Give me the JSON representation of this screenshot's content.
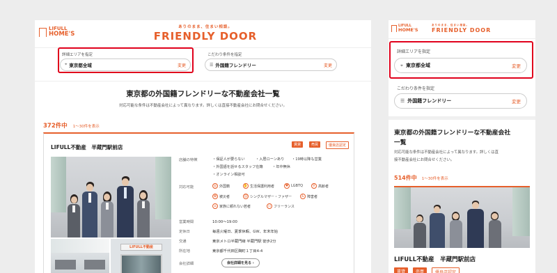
{
  "brand": {
    "logo_top": "LIFULL",
    "logo_bottom": "HOME'S",
    "tagline": "ありのまま、住まい相談。",
    "product": "FRIENDLY DOOR"
  },
  "filters": {
    "area_label": "詳細エリアを指定",
    "area_value": "東京都全域",
    "condition_label": "こだわり条件を指定",
    "condition_value": "外国籍フレンドリー",
    "change": "変更"
  },
  "results": {
    "heading": "東京都の外国籍フレンドリーな不動産会社一覧",
    "heading_mobile_1": "東京都の外国籍フレンドリーな不動産会社",
    "heading_mobile_2": "一覧",
    "note": "対応可能な条件は不動産会社によって異なります。詳しくは直接不動産会社にお問合せください。",
    "note_mobile_1": "対応可能な条件は不動産会社によって異なります。詳しくは直",
    "note_mobile_2": "接不動産会社にお問合せください。",
    "count_desktop": "372件中",
    "count_mobile": "514件中",
    "range": "1〜30件を表示"
  },
  "company": {
    "name_desktop": "LIFULL不動産　半蔵門駅前店",
    "name_mobile": "LIFULL不動産　半蔵門駅前店",
    "badges": [
      "賃貸",
      "売買",
      "優良店認定"
    ],
    "store_sign": "LIFULL不動産",
    "features_label": "店舗の特徴",
    "features": [
      "保証人が要らない",
      "入居ローンあり",
      "19時以降も営業",
      "外国語を話せるスタッフ在籍",
      "年中無休",
      "オンライン相談可"
    ],
    "support_label": "対応可能",
    "support": [
      {
        "icon": "globe",
        "label": "外国籍"
      },
      {
        "icon": "hand",
        "label": "生活保護利用者"
      },
      {
        "icon": "heart",
        "label": "LGBTQ"
      },
      {
        "icon": "person",
        "label": "高齢者"
      },
      {
        "icon": "paw",
        "label": "被災者"
      },
      {
        "icon": "family",
        "label": "シングルマザー・ファザー"
      },
      {
        "icon": "wheel",
        "label": "障害者"
      },
      {
        "icon": "home",
        "label": "家族に頼れない若者"
      },
      {
        "icon": "laptop",
        "label": "フリーランス"
      }
    ],
    "hours_label": "営業時間",
    "hours": "10:00〜19:00",
    "holiday_label": "定休日",
    "holiday": "毎週火曜日、夏季休暇、GW、年末年始",
    "access_label": "交通",
    "access": "東京メトロ半蔵門線 半蔵門駅 徒歩2分",
    "address_label": "所在地",
    "address": "東京都千代田区麹町１丁目4-4",
    "detail_label": "会社詳細",
    "detail_button": "会社詳細を見る"
  },
  "colors": {
    "accent": "#e65f2b",
    "highlight": "#e0001b"
  }
}
